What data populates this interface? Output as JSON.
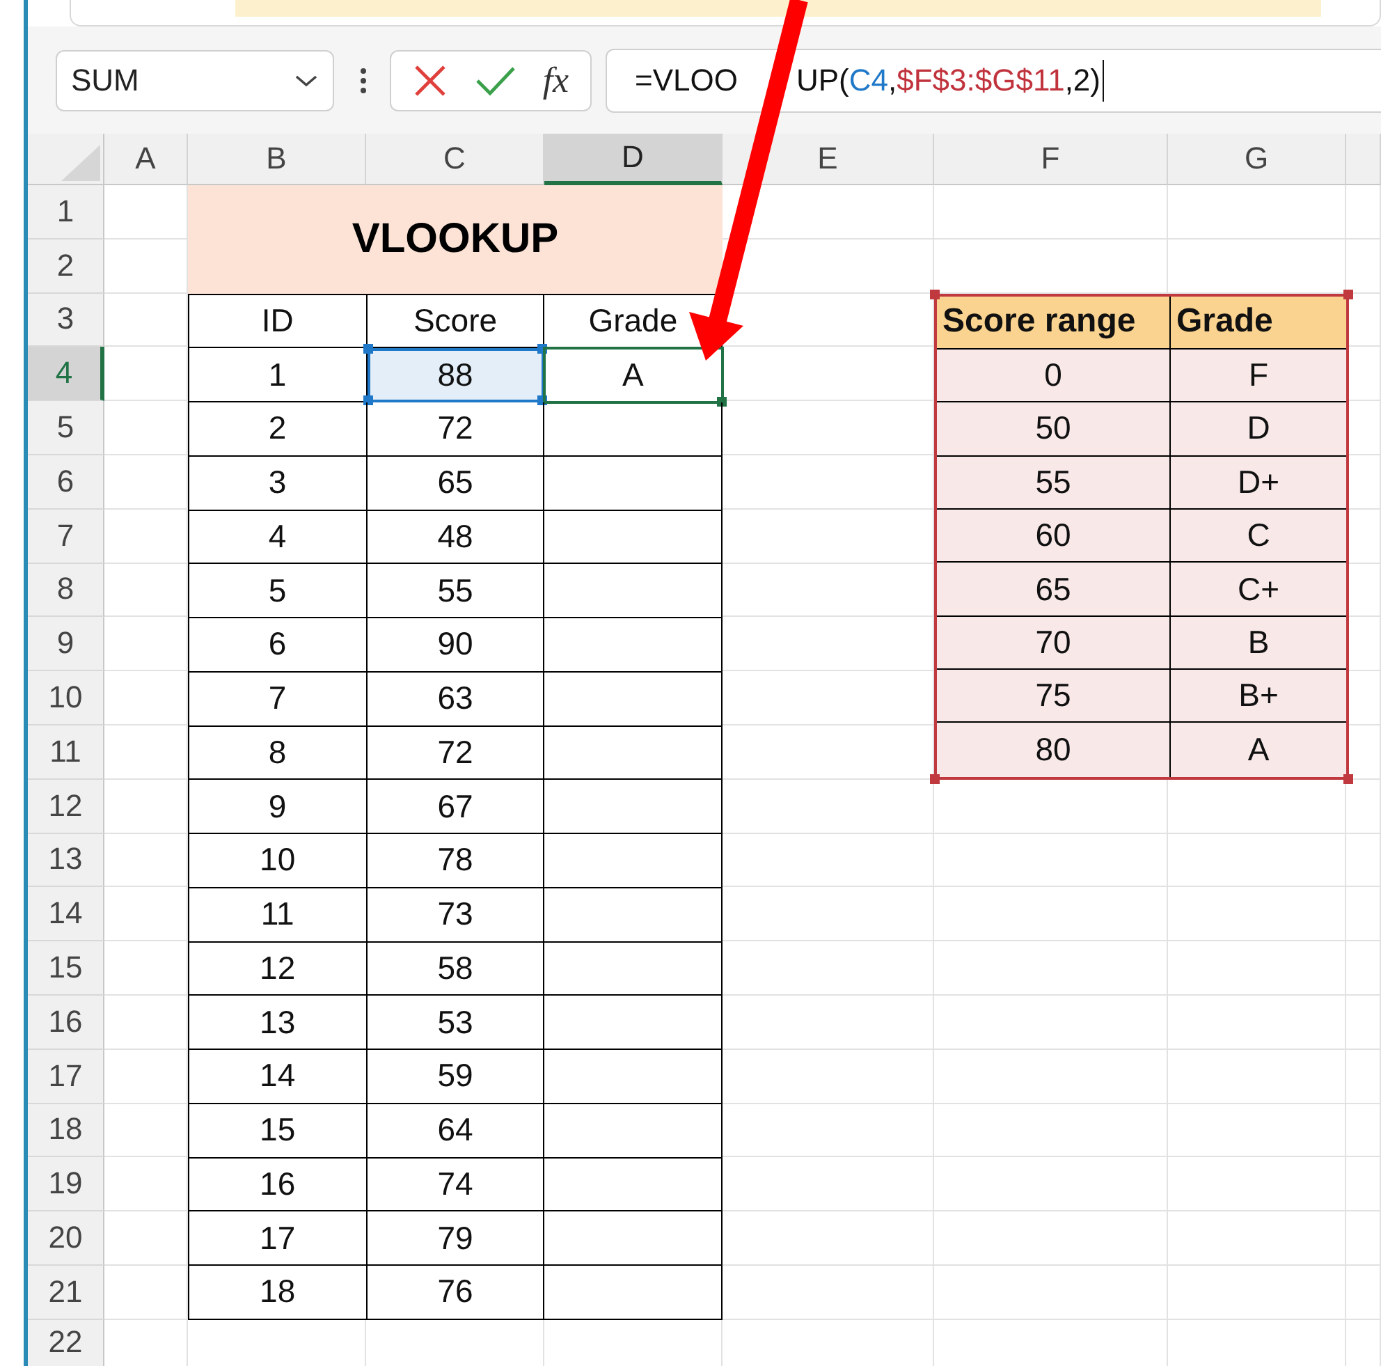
{
  "name_box": "SUM",
  "fx_label": "fx",
  "formula": [
    {
      "text": "=VLOO",
      "kind": "text"
    },
    {
      "text": "UP(",
      "kind": "after_arrow"
    },
    {
      "text": "C4",
      "kind": "ref_blue"
    },
    {
      "text": ",",
      "kind": "text"
    },
    {
      "text": "$F$3:$G$11",
      "kind": "ref_red"
    },
    {
      "text": ",2)",
      "kind": "text"
    }
  ],
  "columns": [
    {
      "label": "A",
      "selected": false
    },
    {
      "label": "B",
      "selected": false
    },
    {
      "label": "C",
      "selected": false
    },
    {
      "label": "D",
      "selected": true
    },
    {
      "label": "E",
      "selected": false
    },
    {
      "label": "F",
      "selected": false
    },
    {
      "label": "G",
      "selected": false
    }
  ],
  "rows": [
    {
      "label": "1",
      "selected": false
    },
    {
      "label": "2",
      "selected": false
    },
    {
      "label": "3",
      "selected": false
    },
    {
      "label": "4",
      "selected": true
    },
    {
      "label": "5",
      "selected": false
    },
    {
      "label": "6",
      "selected": false
    },
    {
      "label": "7",
      "selected": false
    },
    {
      "label": "8",
      "selected": false
    },
    {
      "label": "9",
      "selected": false
    },
    {
      "label": "10",
      "selected": false
    },
    {
      "label": "11",
      "selected": false
    },
    {
      "label": "12",
      "selected": false
    },
    {
      "label": "13",
      "selected": false
    },
    {
      "label": "14",
      "selected": false
    },
    {
      "label": "15",
      "selected": false
    },
    {
      "label": "16",
      "selected": false
    },
    {
      "label": "17",
      "selected": false
    },
    {
      "label": "18",
      "selected": false
    },
    {
      "label": "19",
      "selected": false
    },
    {
      "label": "20",
      "selected": false
    },
    {
      "label": "21",
      "selected": false
    },
    {
      "label": "22",
      "selected": false
    }
  ],
  "title": "VLOOKUP",
  "score_table": {
    "headers": [
      "ID",
      "Score",
      "Grade"
    ],
    "rows": [
      {
        "id": "1",
        "score": "88",
        "grade": "A",
        "score_referenced": true,
        "grade_active": true
      },
      {
        "id": "2",
        "score": "72",
        "score_referenced": false,
        "grade_active": false
      },
      {
        "id": "3",
        "score": "65",
        "score_referenced": false,
        "grade_active": false
      },
      {
        "id": "4",
        "score": "48",
        "score_referenced": false,
        "grade_active": false
      },
      {
        "id": "5",
        "score": "55",
        "score_referenced": false,
        "grade_active": false
      },
      {
        "id": "6",
        "score": "90",
        "score_referenced": false,
        "grade_active": false
      },
      {
        "id": "7",
        "score": "63",
        "score_referenced": false,
        "grade_active": false
      },
      {
        "id": "8",
        "score": "72",
        "score_referenced": false,
        "grade_active": false
      },
      {
        "id": "9",
        "score": "67",
        "score_referenced": false,
        "grade_active": false
      },
      {
        "id": "10",
        "score": "78",
        "score_referenced": false,
        "grade_active": false
      },
      {
        "id": "11",
        "score": "73",
        "score_referenced": false,
        "grade_active": false
      },
      {
        "id": "12",
        "score": "58",
        "score_referenced": false,
        "grade_active": false
      },
      {
        "id": "13",
        "score": "53",
        "score_referenced": false,
        "grade_active": false
      },
      {
        "id": "14",
        "score": "59",
        "score_referenced": false,
        "grade_active": false
      },
      {
        "id": "15",
        "score": "64",
        "score_referenced": false,
        "grade_active": false
      },
      {
        "id": "16",
        "score": "74",
        "score_referenced": false,
        "grade_active": false
      },
      {
        "id": "17",
        "score": "79",
        "score_referenced": false,
        "grade_active": false
      },
      {
        "id": "18",
        "score": "76",
        "score_referenced": false,
        "grade_active": false
      }
    ]
  },
  "lookup_table": {
    "headers": [
      "Score range",
      "Grade"
    ],
    "rows": [
      {
        "score": "0",
        "grade": "F"
      },
      {
        "score": "50",
        "grade": "D"
      },
      {
        "score": "55",
        "grade": "D+"
      },
      {
        "score": "60",
        "grade": "C"
      },
      {
        "score": "65",
        "grade": "C+"
      },
      {
        "score": "70",
        "grade": "B"
      },
      {
        "score": "75",
        "grade": "B+"
      },
      {
        "score": "80",
        "grade": "A"
      }
    ]
  }
}
